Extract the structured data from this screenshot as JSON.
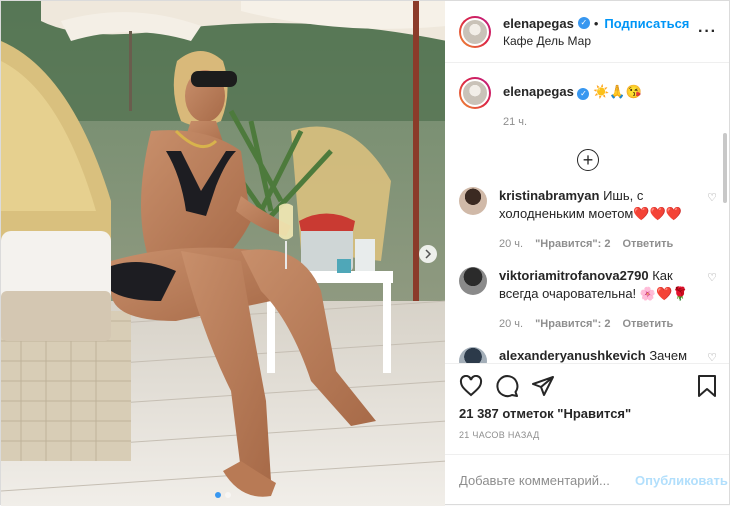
{
  "header": {
    "username": "elenapegas",
    "follow_label": "Подписаться",
    "location": "Кафе Дель Мар",
    "more_icon": "more-horizontal-icon"
  },
  "caption": {
    "username": "elenapegas",
    "text": "☀️🙏😘",
    "time": "21 ч."
  },
  "load_more_icon": "plus-circle-icon",
  "comments": [
    {
      "username": "kristinabramyan",
      "text": "Ишь, с холодненьким моетом❤️❤️❤️",
      "time": "20 ч.",
      "likes": "\"Нравится\": 2",
      "reply": "Ответить"
    },
    {
      "username": "viktoriamitrofanova2790",
      "text": "Как всегда очаровательна! 🌸❤️🌹",
      "time": "20 ч.",
      "likes": "\"Нравится\": 2",
      "reply": "Ответить"
    },
    {
      "username": "alexanderyanushkevich",
      "text": "Зачем людей дразнить",
      "time": "",
      "likes": "",
      "reply": ""
    }
  ],
  "actions": {
    "likes_text": "21 387 отметок \"Нравится\"",
    "timestamp": "21 ЧАСОВ НАЗАД"
  },
  "add_comment": {
    "placeholder": "Добавьте комментарий...",
    "publish_label": "Опубликовать"
  },
  "colors": {
    "accent": "#0095f6",
    "publish_disabled": "#b2dffc",
    "like_heart": "#ed4956"
  }
}
